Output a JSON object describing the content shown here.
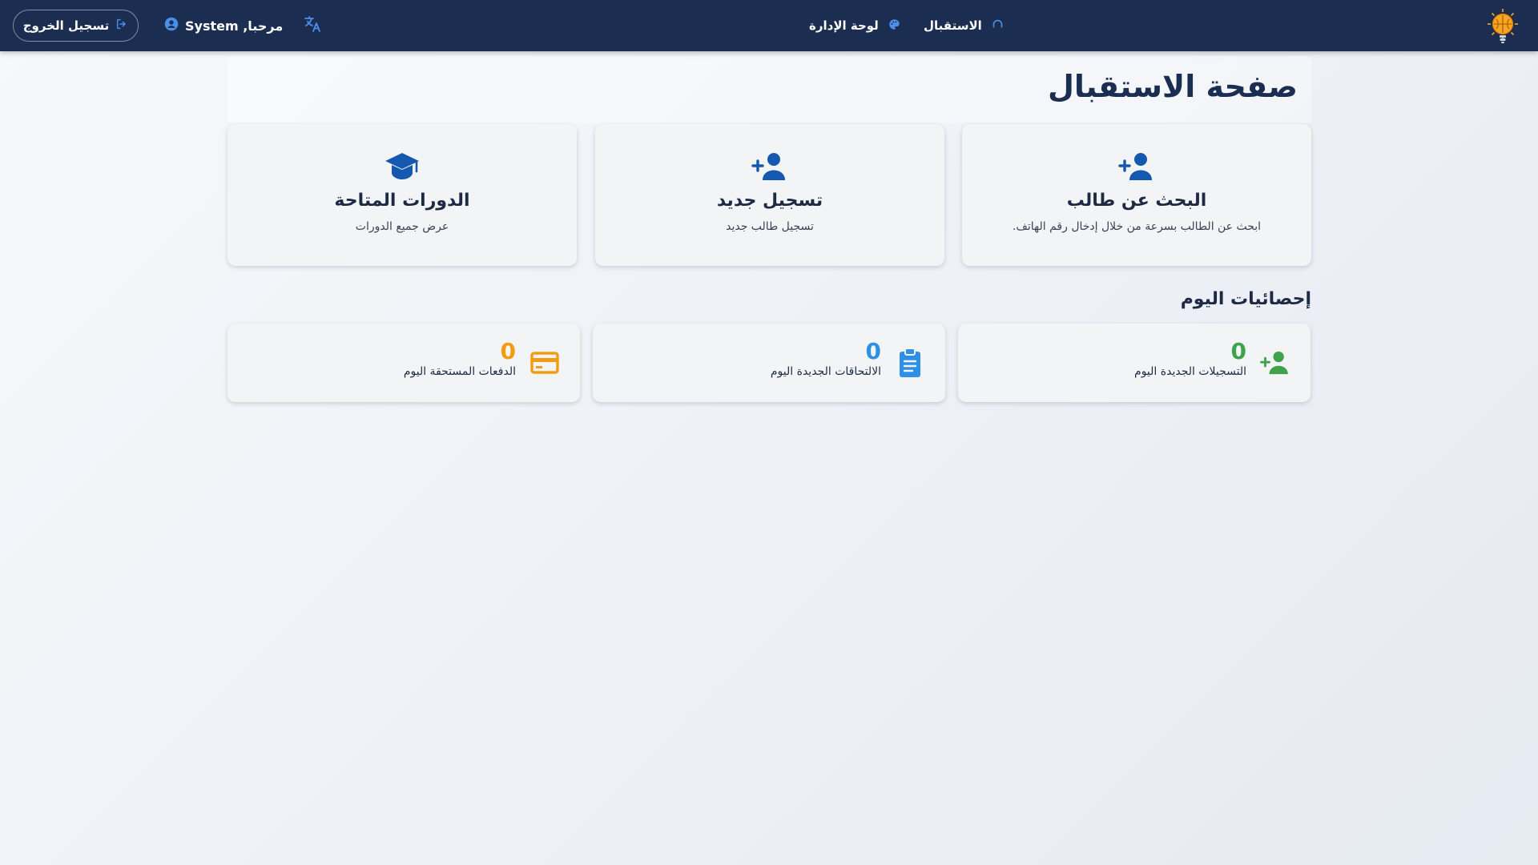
{
  "navbar": {
    "logout_label": "تسجيل الخروج",
    "greeting": "مرحبا, System",
    "translate_icon": "translate-icon",
    "links": {
      "admin": "لوحة الإدارة",
      "reception": "الاستقبال"
    }
  },
  "page": {
    "title": "صفحة الاستقبال"
  },
  "actions": {
    "search": {
      "title": "البحث عن طالب",
      "description": "ابحث عن الطالب بسرعة من خلال إدخال رقم الهاتف.",
      "icon": "person-add-icon"
    },
    "register": {
      "title": "تسجيل جديد",
      "description": "تسجيل طالب جديد",
      "icon": "person-add-icon"
    },
    "courses": {
      "title": "الدورات المتاحة",
      "description": "عرض جميع الدورات",
      "icon": "graduation-cap-icon"
    }
  },
  "stats": {
    "section_title": "إحصائيات اليوم",
    "registrations": {
      "value": "0",
      "label": "التسجيلات الجديدة اليوم",
      "color": "#3fa34d",
      "icon": "person-add-icon"
    },
    "enrollments": {
      "value": "0",
      "label": "الالتحاقات الجديدة اليوم",
      "color": "#2d8fe6",
      "icon": "clipboard-icon"
    },
    "payments": {
      "value": "0",
      "label": "الدفعات المستحقة اليوم",
      "color": "#f39c12",
      "icon": "credit-card-icon"
    }
  },
  "colors": {
    "navbar": "#1b2e52",
    "primary_icon": "#1558b0"
  }
}
